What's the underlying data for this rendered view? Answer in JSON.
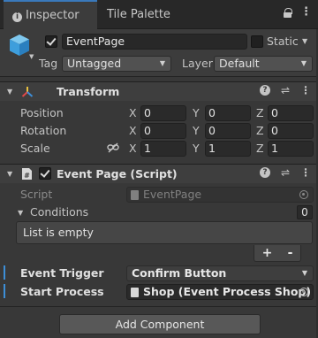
{
  "tabs": [
    {
      "label": "Inspector",
      "icon": "info-icon"
    },
    {
      "label": "Tile Palette"
    }
  ],
  "header": {
    "object_name": "EventPage",
    "active": true,
    "static_label": "Static",
    "tag_label": "Tag",
    "tag_value": "Untagged",
    "layer_label": "Layer",
    "layer_value": "Default"
  },
  "transform": {
    "title": "Transform",
    "rows": [
      {
        "label": "Position",
        "x": "0",
        "y": "0",
        "z": "0"
      },
      {
        "label": "Rotation",
        "x": "0",
        "y": "0",
        "z": "0"
      },
      {
        "label": "Scale",
        "x": "1",
        "y": "1",
        "z": "1"
      }
    ],
    "axis": {
      "x": "X",
      "y": "Y",
      "z": "Z"
    }
  },
  "event_page": {
    "title": "Event Page (Script)",
    "enabled": true,
    "script_label": "Script",
    "script_value": "EventPage",
    "conditions_label": "Conditions",
    "conditions_count": "0",
    "list_empty_text": "List is empty",
    "add_symbol": "+",
    "remove_symbol": "-",
    "trigger_label": "Event Trigger",
    "trigger_value": "Confirm Button",
    "process_label": "Start Process",
    "process_value": "Shop (Event Process Shop)"
  },
  "add_component_label": "Add Component",
  "colors": {
    "accent": "#3a79bb",
    "panel": "#383838",
    "tabbar": "#282828",
    "transform_icon": [
      "#e04848",
      "#5cb85c",
      "#3d8ed7"
    ]
  }
}
